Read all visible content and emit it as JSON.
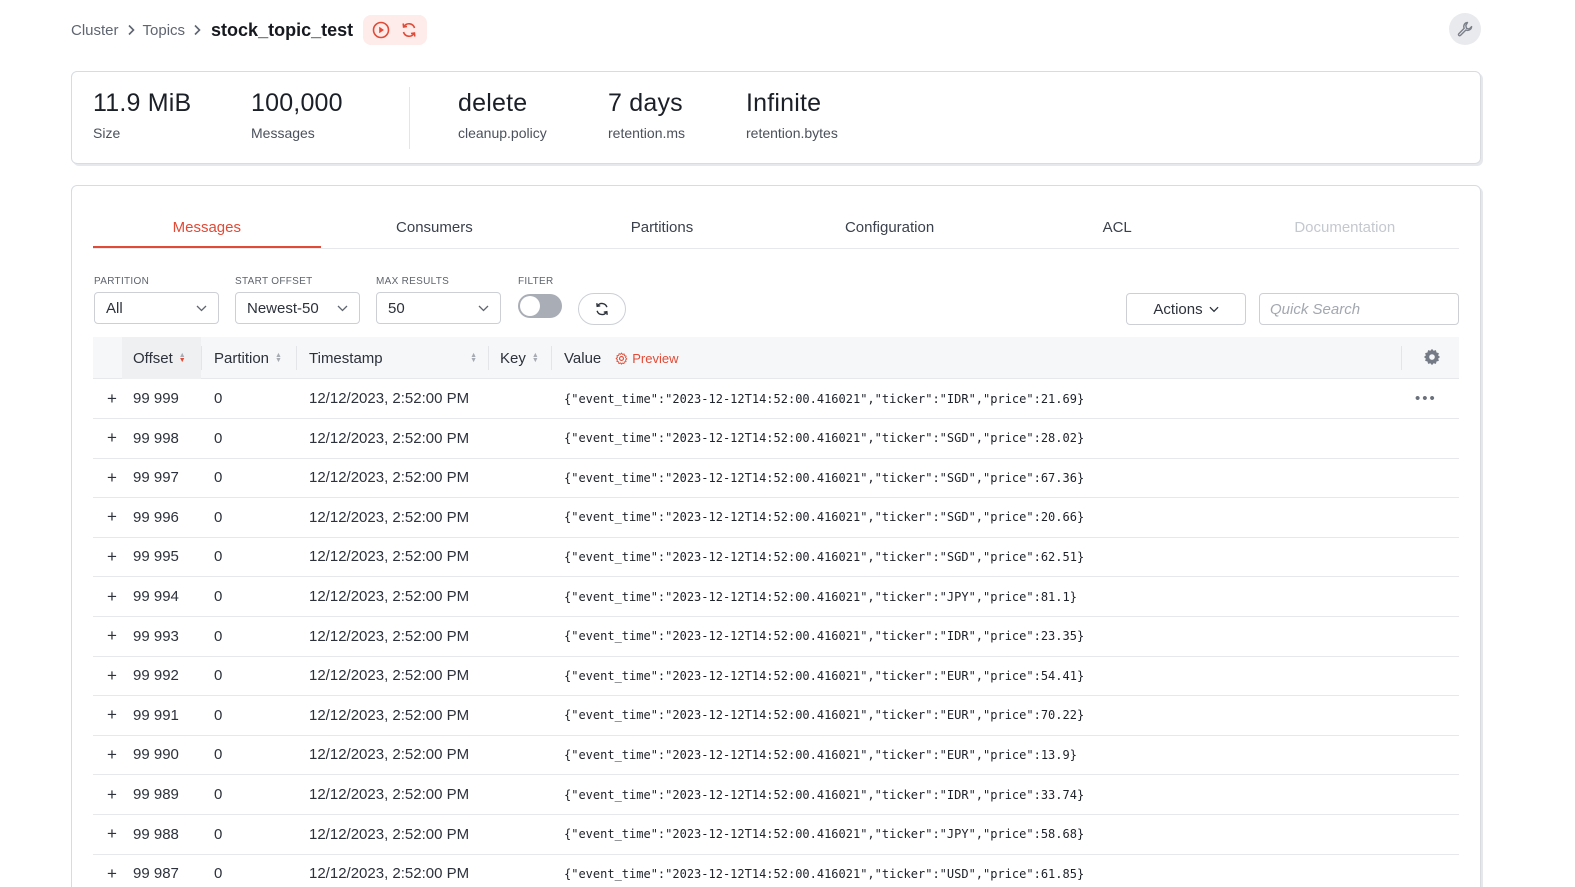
{
  "breadcrumb": {
    "items": [
      "Cluster",
      "Topics"
    ],
    "title": "stock_topic_test"
  },
  "icons": {
    "play": "play-circle-icon",
    "refresh": "refresh-icon",
    "wrench": "wrench-icon",
    "settings": "gear-icon",
    "more": "more-horizontal-icon"
  },
  "colors": {
    "accent": "#e14a36"
  },
  "stats": [
    {
      "value": "11.9 MiB",
      "label": "Size"
    },
    {
      "value": "100,000",
      "label": "Messages"
    },
    {
      "value": "delete",
      "label": "cleanup.policy"
    },
    {
      "value": "7 days",
      "label": "retention.ms"
    },
    {
      "value": "Infinite",
      "label": "retention.bytes"
    }
  ],
  "tabs": [
    {
      "label": "Messages",
      "state": "active"
    },
    {
      "label": "Consumers",
      "state": "normal"
    },
    {
      "label": "Partitions",
      "state": "normal"
    },
    {
      "label": "Configuration",
      "state": "normal"
    },
    {
      "label": "ACL",
      "state": "normal"
    },
    {
      "label": "Documentation",
      "state": "disabled"
    }
  ],
  "filters": {
    "partition": {
      "label": "PARTITION",
      "value": "All"
    },
    "start_offset": {
      "label": "START OFFSET",
      "value": "Newest-50"
    },
    "max_results": {
      "label": "MAX RESULTS",
      "value": "50"
    },
    "filter": {
      "label": "FILTER",
      "enabled": false
    }
  },
  "actions_label": "Actions",
  "search": {
    "placeholder": "Quick Search",
    "value": ""
  },
  "table": {
    "headers": {
      "offset": "Offset",
      "partition": "Partition",
      "timestamp": "Timestamp",
      "key": "Key",
      "value": "Value",
      "preview": "Preview"
    },
    "rows": [
      {
        "offset": "99 999",
        "partition": "0",
        "timestamp": "12/12/2023, 2:52:00 PM",
        "key": "",
        "value": "{\"event_time\":\"2023-12-12T14:52:00.416021\",\"ticker\":\"IDR\",\"price\":21.69}"
      },
      {
        "offset": "99 998",
        "partition": "0",
        "timestamp": "12/12/2023, 2:52:00 PM",
        "key": "",
        "value": "{\"event_time\":\"2023-12-12T14:52:00.416021\",\"ticker\":\"SGD\",\"price\":28.02}"
      },
      {
        "offset": "99 997",
        "partition": "0",
        "timestamp": "12/12/2023, 2:52:00 PM",
        "key": "",
        "value": "{\"event_time\":\"2023-12-12T14:52:00.416021\",\"ticker\":\"SGD\",\"price\":67.36}"
      },
      {
        "offset": "99 996",
        "partition": "0",
        "timestamp": "12/12/2023, 2:52:00 PM",
        "key": "",
        "value": "{\"event_time\":\"2023-12-12T14:52:00.416021\",\"ticker\":\"SGD\",\"price\":20.66}"
      },
      {
        "offset": "99 995",
        "partition": "0",
        "timestamp": "12/12/2023, 2:52:00 PM",
        "key": "",
        "value": "{\"event_time\":\"2023-12-12T14:52:00.416021\",\"ticker\":\"SGD\",\"price\":62.51}"
      },
      {
        "offset": "99 994",
        "partition": "0",
        "timestamp": "12/12/2023, 2:52:00 PM",
        "key": "",
        "value": "{\"event_time\":\"2023-12-12T14:52:00.416021\",\"ticker\":\"JPY\",\"price\":81.1}"
      },
      {
        "offset": "99 993",
        "partition": "0",
        "timestamp": "12/12/2023, 2:52:00 PM",
        "key": "",
        "value": "{\"event_time\":\"2023-12-12T14:52:00.416021\",\"ticker\":\"IDR\",\"price\":23.35}"
      },
      {
        "offset": "99 992",
        "partition": "0",
        "timestamp": "12/12/2023, 2:52:00 PM",
        "key": "",
        "value": "{\"event_time\":\"2023-12-12T14:52:00.416021\",\"ticker\":\"EUR\",\"price\":54.41}"
      },
      {
        "offset": "99 991",
        "partition": "0",
        "timestamp": "12/12/2023, 2:52:00 PM",
        "key": "",
        "value": "{\"event_time\":\"2023-12-12T14:52:00.416021\",\"ticker\":\"EUR\",\"price\":70.22}"
      },
      {
        "offset": "99 990",
        "partition": "0",
        "timestamp": "12/12/2023, 2:52:00 PM",
        "key": "",
        "value": "{\"event_time\":\"2023-12-12T14:52:00.416021\",\"ticker\":\"EUR\",\"price\":13.9}"
      },
      {
        "offset": "99 989",
        "partition": "0",
        "timestamp": "12/12/2023, 2:52:00 PM",
        "key": "",
        "value": "{\"event_time\":\"2023-12-12T14:52:00.416021\",\"ticker\":\"IDR\",\"price\":33.74}"
      },
      {
        "offset": "99 988",
        "partition": "0",
        "timestamp": "12/12/2023, 2:52:00 PM",
        "key": "",
        "value": "{\"event_time\":\"2023-12-12T14:52:00.416021\",\"ticker\":\"JPY\",\"price\":58.68}"
      },
      {
        "offset": "99 987",
        "partition": "0",
        "timestamp": "12/12/2023, 2:52:00 PM",
        "key": "",
        "value": "{\"event_time\":\"2023-12-12T14:52:00.416021\",\"ticker\":\"USD\",\"price\":61.85}"
      }
    ]
  }
}
